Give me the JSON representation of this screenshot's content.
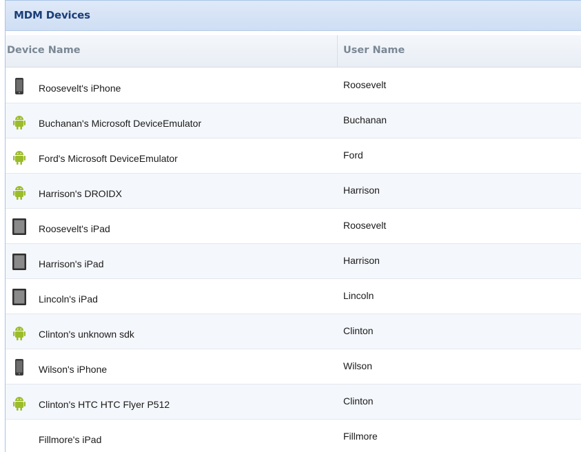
{
  "panel": {
    "title": "MDM Devices"
  },
  "columns": {
    "device": "Device Name",
    "user": "User Name"
  },
  "colors": {
    "android_green": "#9cbc2c",
    "header_title": "#1b3e78"
  },
  "rows": [
    {
      "icon": "phone-icon",
      "device": "Roosevelt's iPhone",
      "user": "Roosevelt"
    },
    {
      "icon": "android-icon",
      "device": "Buchanan's Microsoft DeviceEmulator",
      "user": "Buchanan"
    },
    {
      "icon": "android-icon",
      "device": "Ford's Microsoft DeviceEmulator",
      "user": "Ford"
    },
    {
      "icon": "android-icon",
      "device": "Harrison's DROIDX",
      "user": "Harrison"
    },
    {
      "icon": "tablet-icon",
      "device": "Roosevelt's iPad",
      "user": "Roosevelt"
    },
    {
      "icon": "tablet-icon",
      "device": "Harrison's iPad",
      "user": "Harrison"
    },
    {
      "icon": "tablet-icon",
      "device": "Lincoln's iPad",
      "user": "Lincoln"
    },
    {
      "icon": "android-icon",
      "device": "Clinton's unknown sdk",
      "user": "Clinton"
    },
    {
      "icon": "phone-icon",
      "device": "Wilson's iPhone",
      "user": "Wilson"
    },
    {
      "icon": "android-icon",
      "device": "Clinton's HTC HTC Flyer P512",
      "user": "Clinton"
    },
    {
      "icon": "none",
      "device": "Fillmore's iPad",
      "user": "Fillmore"
    }
  ]
}
